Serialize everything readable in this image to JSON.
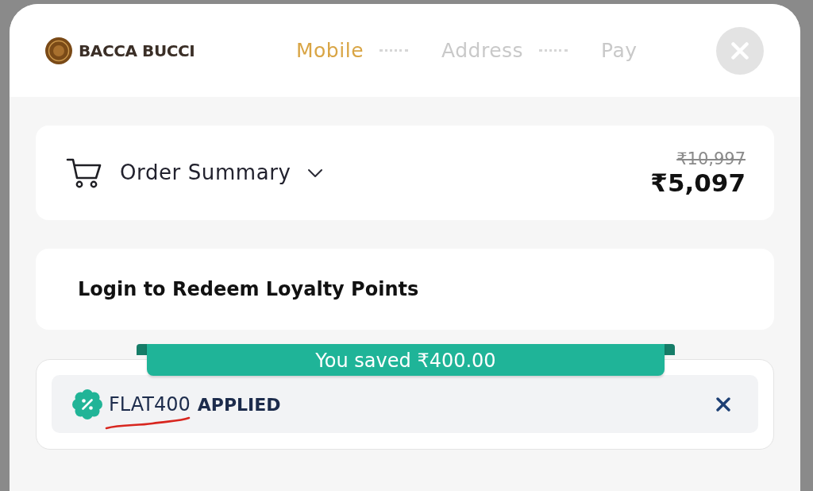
{
  "header": {
    "brand": "BACCA BUCCI",
    "steps": [
      {
        "label": "Mobile",
        "selected": true
      },
      {
        "label": "Address",
        "selected": false
      },
      {
        "label": "Pay",
        "selected": false
      }
    ]
  },
  "order_summary": {
    "title": "Order Summary",
    "expanded": false,
    "original_price": "₹10,997",
    "price": "₹5,097"
  },
  "loyalty": {
    "text": "Login to Redeem Loyalty Points"
  },
  "coupon": {
    "savings": "You saved ₹400.00",
    "code": "FLAT400",
    "status": "APPLIED"
  }
}
